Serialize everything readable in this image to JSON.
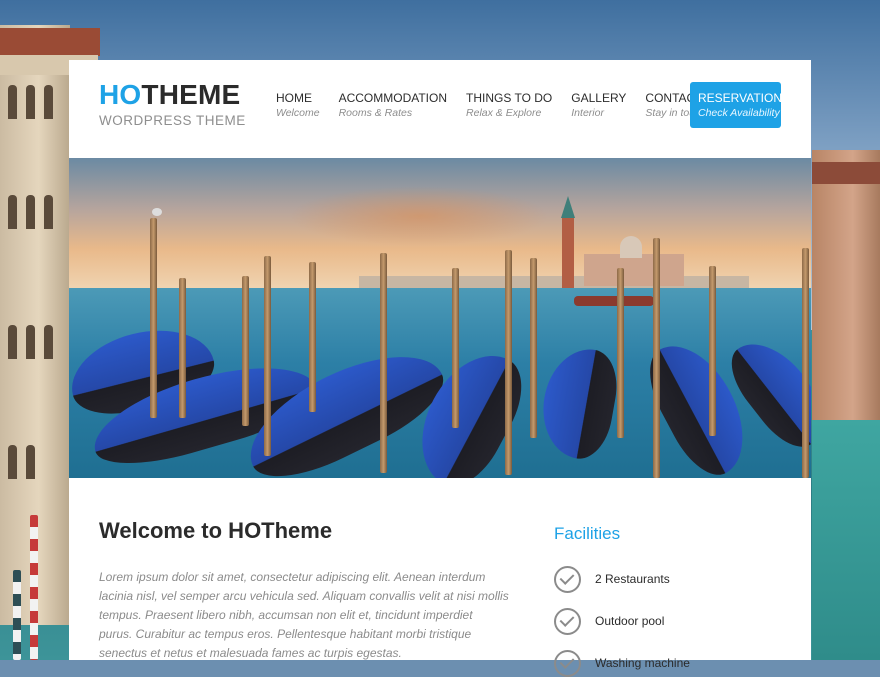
{
  "header": {
    "logo": {
      "accent": "HO",
      "rest": "THEME",
      "tagline": "WORDPRESS THEME"
    },
    "nav": [
      {
        "label": "HOME",
        "sub": "Welcome"
      },
      {
        "label": "ACCOMMODATION",
        "sub": "Rooms & Rates"
      },
      {
        "label": "THINGS TO DO",
        "sub": "Relax & Explore"
      },
      {
        "label": "GALLERY",
        "sub": "Interior"
      },
      {
        "label": "CONTACT",
        "sub": "Stay in touch"
      }
    ],
    "cta": {
      "label": "RESERVATION",
      "sub": "Check Availability"
    }
  },
  "content": {
    "title": "Welcome to HOTheme",
    "body": "Lorem ipsum dolor sit amet, consectetur adipiscing elit. Aenean interdum lacinia nisl, vel semper arcu vehicula sed. Aliquam convallis velit at nisi mollis tempus. Praesent libero nibh, accumsan non elit et, tincidunt imperdiet purus. Curabitur ac tempus eros. Pellentesque habitant morbi tristique senectus et netus et malesuada fames ac turpis egestas."
  },
  "facilities": {
    "title": "Facilities",
    "items": [
      {
        "label": "2 Restaurants",
        "icon": "check-circle-icon"
      },
      {
        "label": "Outdoor pool",
        "icon": "check-circle-icon"
      },
      {
        "label": "Washing machine",
        "icon": "check-circle-icon"
      }
    ]
  },
  "colors": {
    "accent": "#1ea2e6",
    "text": "#2b2b2b",
    "muted": "#8b8b8b"
  }
}
